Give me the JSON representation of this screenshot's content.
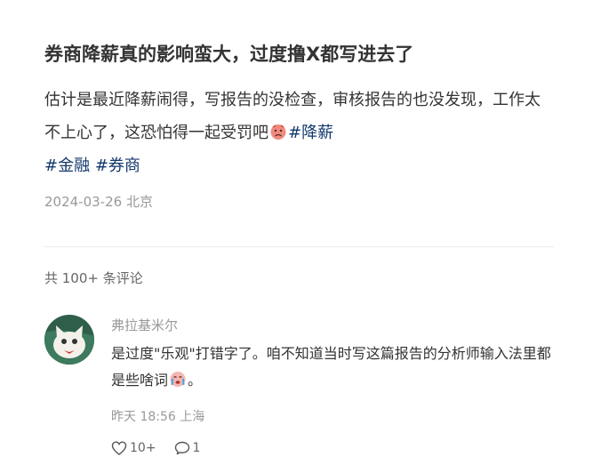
{
  "post": {
    "title": "券商降薪真的影响蛮大，过度撸X都写进去了",
    "body_text": "估计是最近降薪闹得，写报告的没检查，审核报告的也没发现，工作太不上心了，这恐怕得一起受罚吧",
    "emoji_icon": "sad-face-emoji-icon",
    "tags": [
      "#降薪",
      "#金融",
      "#券商"
    ],
    "date": "2024-03-26",
    "location": "北京"
  },
  "comments": {
    "count_label": "共 100+ 条评论",
    "items": [
      {
        "user": "弗拉基米尔",
        "text": "是过度\"乐观\"打错字了。咱不知道当时写这篇报告的分析师输入法里都是些啥词",
        "text_end": "。",
        "emoji_icon": "crying-face-emoji-icon",
        "time": "昨天 18:56",
        "location": "上海",
        "likes": "10+",
        "replies": "1"
      }
    ]
  },
  "colors": {
    "text": "#333333",
    "muted": "#999999",
    "tag": "#13386c",
    "divider": "#ececec"
  }
}
